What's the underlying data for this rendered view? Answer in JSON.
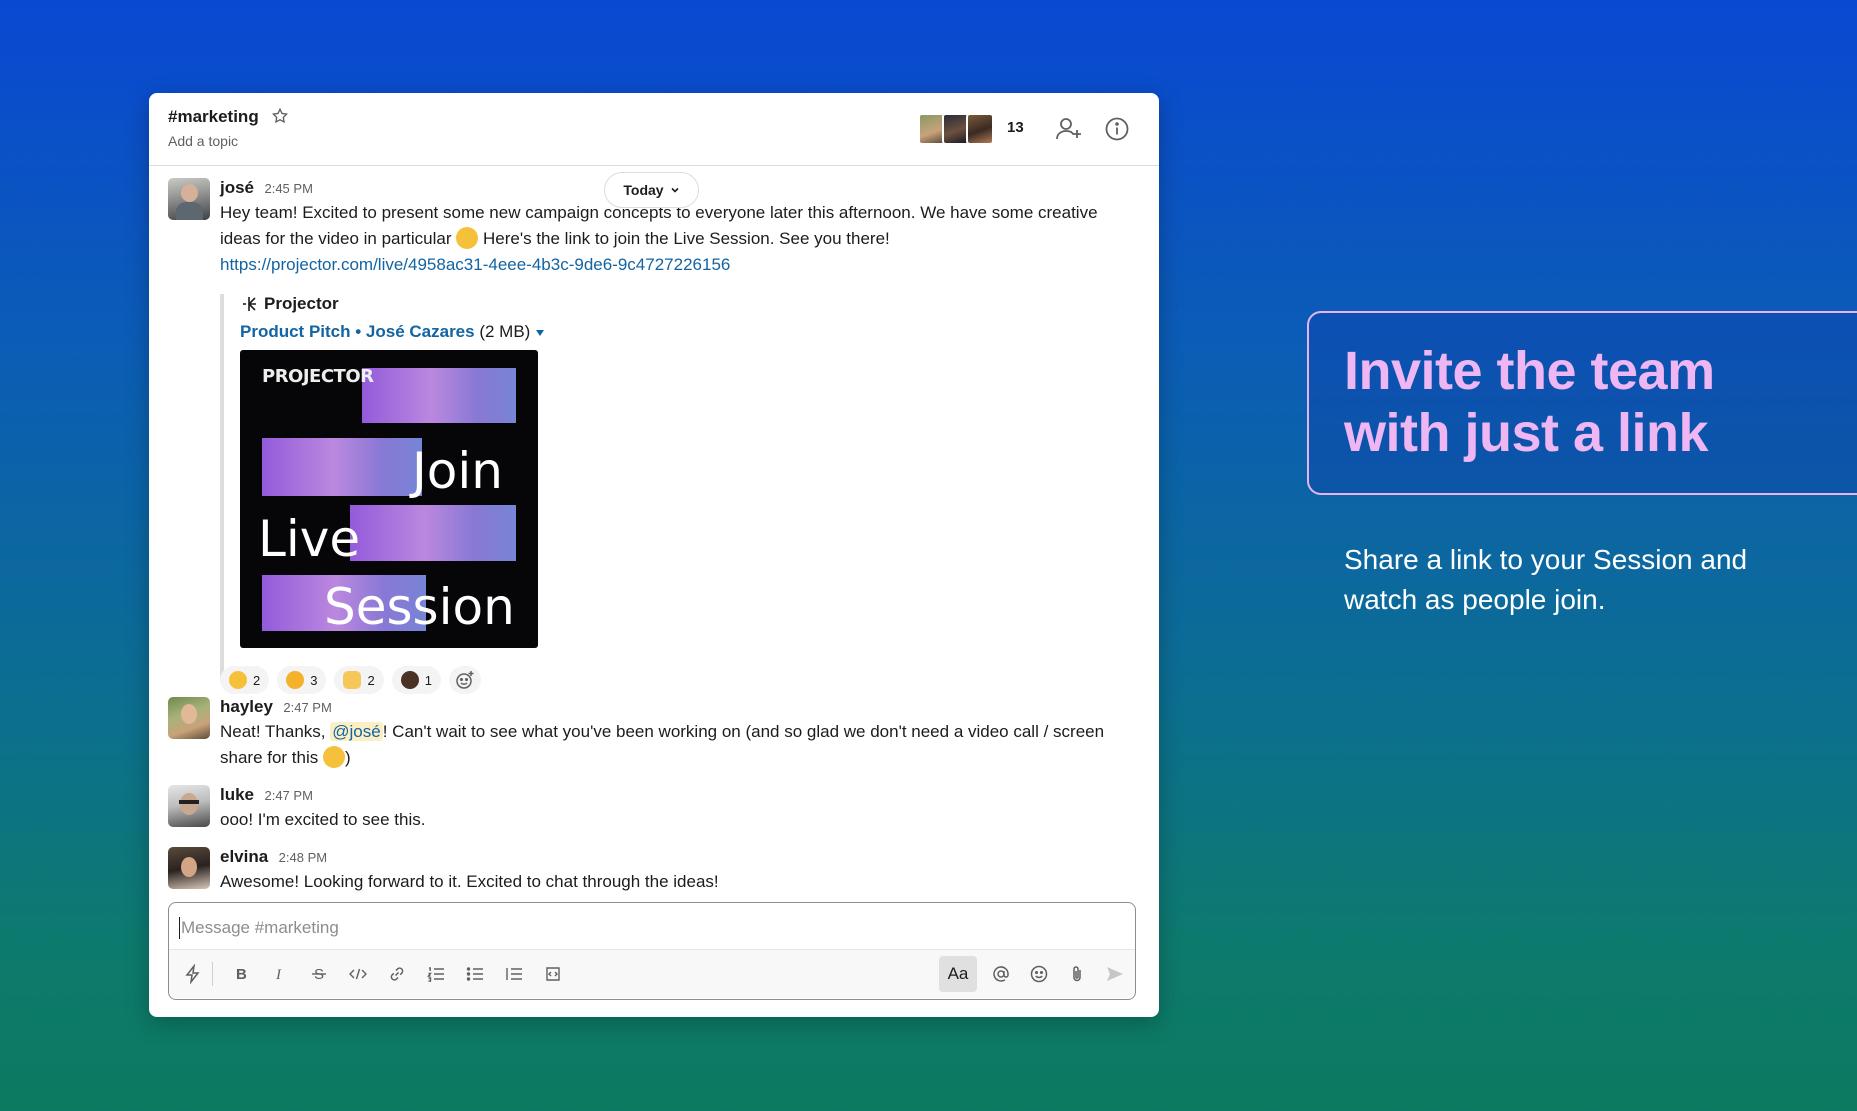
{
  "channel": {
    "name": "#marketing",
    "topic": "Add a topic",
    "member_count": "13"
  },
  "date_divider": "Today",
  "messages": [
    {
      "author": "josé",
      "time": "2:45 PM",
      "text_a": "Hey team! Excited to present some new campaign concepts to everyone later this afternoon. We have some creative ideas for the video in particular",
      "text_b": "Here's the link to join the Live Session. See you there!",
      "link": "https://projector.com/live/4958ac31-4eee-4b3c-9de6-9c4727226156",
      "attachment": {
        "service": "Projector",
        "file_title": "Product Pitch • José Cazares",
        "file_size": "(2 MB)",
        "thumbnail_brand": "PROJECTOR",
        "thumbnail_words": [
          "Join",
          "Live",
          "Session"
        ]
      },
      "reactions": [
        {
          "emoji": "surprised-face",
          "count": "2"
        },
        {
          "emoji": "star-struck-face",
          "count": "3"
        },
        {
          "emoji": "raised-hands",
          "count": "2"
        },
        {
          "emoji": "person-avatar",
          "count": "1"
        }
      ]
    },
    {
      "author": "hayley",
      "time": "2:47 PM",
      "text_a": "Neat! Thanks,",
      "mention": "@josé",
      "text_b": "! Can't wait to see what you've been working on (and so glad we don't need a video call / screen share for this",
      "text_c": ")"
    },
    {
      "author": "luke",
      "time": "2:47 PM",
      "text": "ooo! I'm excited to see this."
    },
    {
      "author": "elvina",
      "time": "2:48 PM",
      "text": "Awesome! Looking forward to it. Excited to chat through the ideas!"
    }
  ],
  "composer": {
    "placeholder": "Message #marketing",
    "format_label": "Aa"
  },
  "marketing": {
    "headline": "Invite the team with just a link",
    "subtext": "Share a link to your Session and watch as people join."
  }
}
